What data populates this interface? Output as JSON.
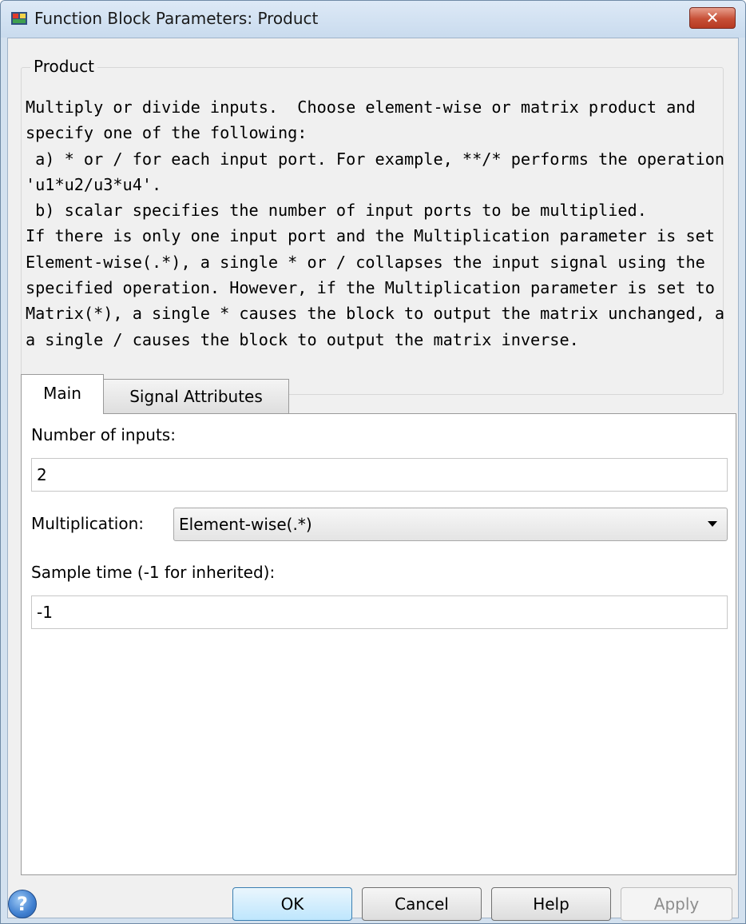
{
  "window": {
    "title": "Function Block Parameters: Product",
    "close_label": "✕"
  },
  "description": {
    "group_title": "Product",
    "lines": [
      "Multiply or divide inputs.  Choose element-wise or matrix product and",
      "specify one of the following:",
      " a) * or / for each input port. For example, **/* performs the operation",
      "'u1*u2/u3*u4'.",
      " b) scalar specifies the number of input ports to be multiplied.",
      "If there is only one input port and the Multiplication parameter is set to",
      "Element-wise(.*), a single * or / collapses the input signal using the",
      "specified operation. However, if the Multiplication parameter is set to",
      "Matrix(*), a single * causes the block to output the matrix unchanged, and",
      "a single / causes the block to output the matrix inverse."
    ]
  },
  "tabs": [
    {
      "label": "Main",
      "active": true
    },
    {
      "label": "Signal Attributes",
      "active": false
    }
  ],
  "main": {
    "num_inputs_label": "Number of inputs:",
    "num_inputs_value": "2",
    "multiplication_label": "Multiplication:",
    "multiplication_value": "Element-wise(.*)",
    "sample_time_label": "Sample time (-1 for inherited):",
    "sample_time_value": "-1"
  },
  "buttons": {
    "help_icon": "?",
    "ok": "OK",
    "cancel": "Cancel",
    "help": "Help",
    "apply": "Apply",
    "apply_enabled": false
  },
  "colors": {
    "title_bar": "#c9dbee",
    "close_button": "#c74f36",
    "client_background": "#f0f0f0",
    "ok_button": "#bee6fd"
  },
  "icons": {
    "app": "simulink-block-icon",
    "close": "close-icon",
    "help": "help-question-icon",
    "dropdown": "chevron-down-icon"
  }
}
